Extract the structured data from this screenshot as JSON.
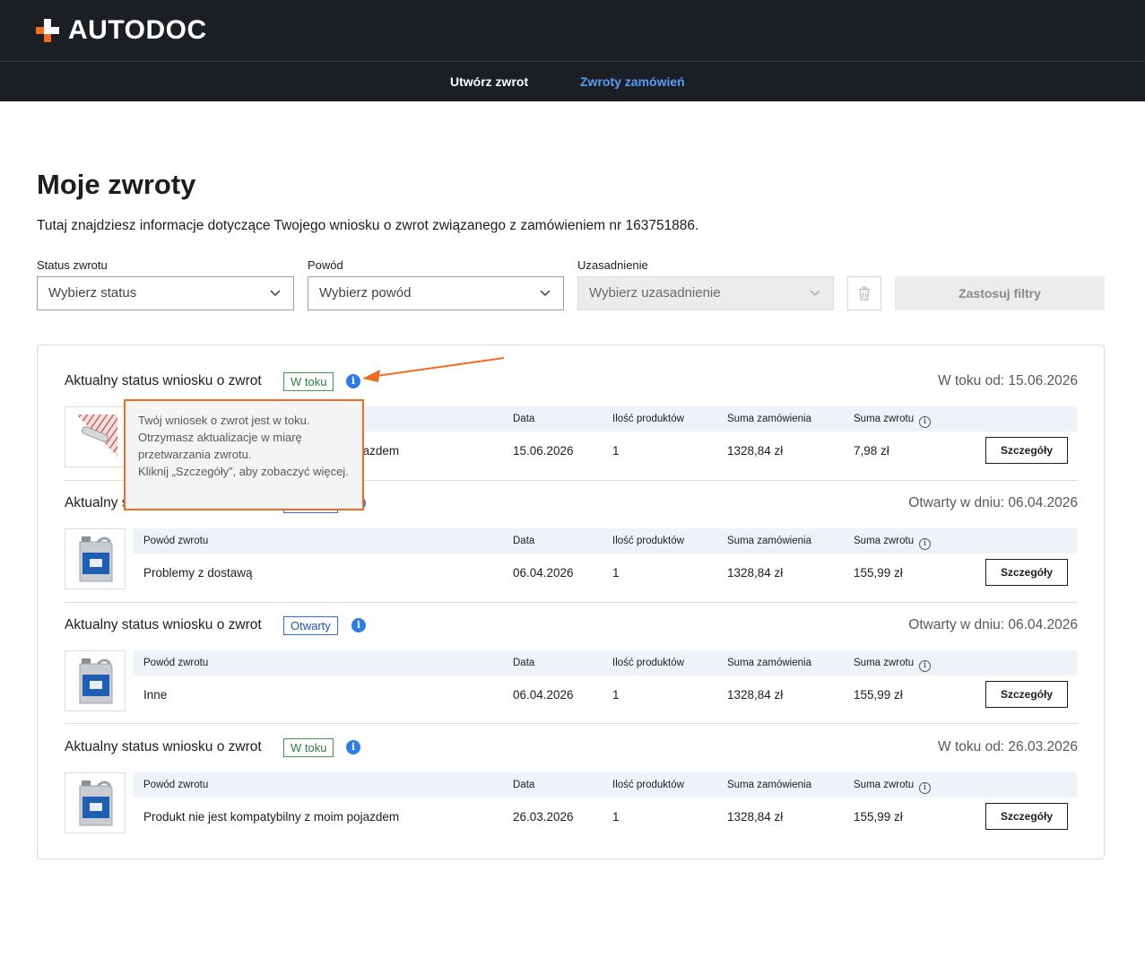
{
  "brand": {
    "name": "AUTODOC",
    "accent": "#f36b21"
  },
  "nav": {
    "create_return": "Utwórz zwrot",
    "order_returns": "Zwroty zamówień"
  },
  "page": {
    "title": "Moje zwroty",
    "description": "Tutaj znajdziesz informacje dotyczące Twojego wniosku o zwrot związanego z zamówieniem nr 163751886."
  },
  "filters": {
    "status": {
      "label": "Status zwrotu",
      "placeholder": "Wybierz status"
    },
    "reason": {
      "label": "Powód",
      "placeholder": "Wybierz powód"
    },
    "justification": {
      "label": "Uzasadnienie",
      "placeholder": "Wybierz uzasadnienie",
      "disabled": true
    },
    "clear_icon": "trash-icon",
    "apply_label": "Zastosuj filtry"
  },
  "columns": {
    "reason": "Powód zwrotu",
    "date": "Data",
    "qty": "Ilość produktów",
    "order_sum": "Suma zamówienia",
    "refund_sum": "Suma zwrotu"
  },
  "returns": [
    {
      "status_title": "Aktualny status wniosku o zwrot",
      "status": "W toku",
      "status_color": "green",
      "since": "W toku od: 15.06.2026",
      "product_image": "wiper-blade-image",
      "reason": "Produkt nie jest kompatybilny z moim pojazdem",
      "date": "15.06.2026",
      "qty": "1",
      "order_sum": "1328,84 zł",
      "refund_sum": "7,98 zł",
      "details_label": "Szczegóły"
    },
    {
      "status_title": "Aktualny status wniosku o zwrot",
      "status": "Otwarty",
      "status_color": "blue",
      "since": "Otwarty w dniu: 06.04.2026",
      "product_image": "oil-canister-image",
      "reason": "Problemy z dostawą",
      "date": "06.04.2026",
      "qty": "1",
      "order_sum": "1328,84 zł",
      "refund_sum": "155,99 zł",
      "details_label": "Szczegóły"
    },
    {
      "status_title": "Aktualny status wniosku o zwrot",
      "status": "Otwarty",
      "status_color": "blue",
      "since": "Otwarty w dniu: 06.04.2026",
      "product_image": "oil-canister-image",
      "reason": "Inne",
      "date": "06.04.2026",
      "qty": "1",
      "order_sum": "1328,84 zł",
      "refund_sum": "155,99 zł",
      "details_label": "Szczegóły"
    },
    {
      "status_title": "Aktualny status wniosku o zwrot",
      "status": "W toku",
      "status_color": "green",
      "since": "W toku od: 26.03.2026",
      "product_image": "oil-canister-image",
      "reason": "Produkt nie jest kompatybilny z moim pojazdem",
      "date": "26.03.2026",
      "qty": "1",
      "order_sum": "1328,84 zł",
      "refund_sum": "155,99 zł",
      "details_label": "Szczegóły"
    }
  ],
  "tooltip": {
    "line1": "Twój wniosek o zwrot jest w toku.",
    "line2": "Otrzymasz aktualizacje w miarę przetwarzania zwrotu.",
    "line3": "Kliknij „Szczegóły”, aby zobaczyć więcej."
  },
  "colors": {
    "topbar": "#1b1e23",
    "nav_active": "#5b9cf6",
    "info": "#2e7bea",
    "highlight": "#f36b21"
  }
}
